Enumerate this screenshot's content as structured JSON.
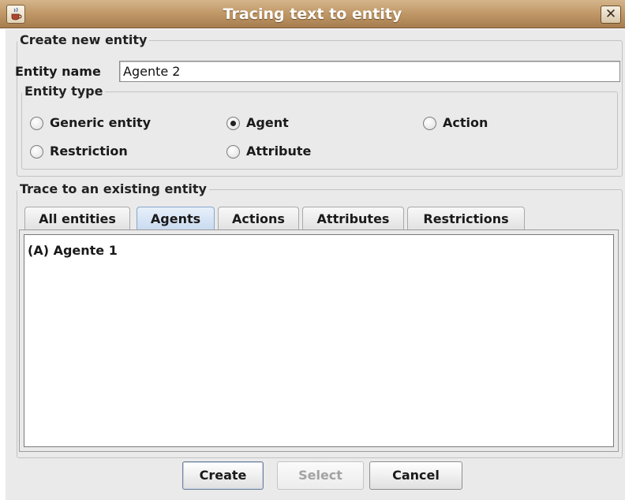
{
  "window": {
    "title": "Tracing text to entity",
    "app_icon": "java-cup-icon",
    "close_glyph": "✕"
  },
  "create_group": {
    "legend": "Create new entity",
    "entity_name_label": "Entity name",
    "entity_name_value": "Agente 2",
    "type_group": {
      "legend": "Entity type",
      "options": [
        {
          "label": "Generic entity",
          "selected": false
        },
        {
          "label": "Agent",
          "selected": true
        },
        {
          "label": "Action",
          "selected": false
        },
        {
          "label": "Restriction",
          "selected": false
        },
        {
          "label": "Attribute",
          "selected": false
        }
      ]
    }
  },
  "trace_group": {
    "legend": "Trace to an existing entity",
    "tabs": [
      {
        "label": "All entities",
        "active": false
      },
      {
        "label": "Agents",
        "active": true
      },
      {
        "label": "Actions",
        "active": false
      },
      {
        "label": "Attributes",
        "active": false
      },
      {
        "label": "Restrictions",
        "active": false
      }
    ],
    "list_items": [
      "(A) Agente 1"
    ]
  },
  "buttons": {
    "create": "Create",
    "select": "Select",
    "cancel": "Cancel"
  }
}
